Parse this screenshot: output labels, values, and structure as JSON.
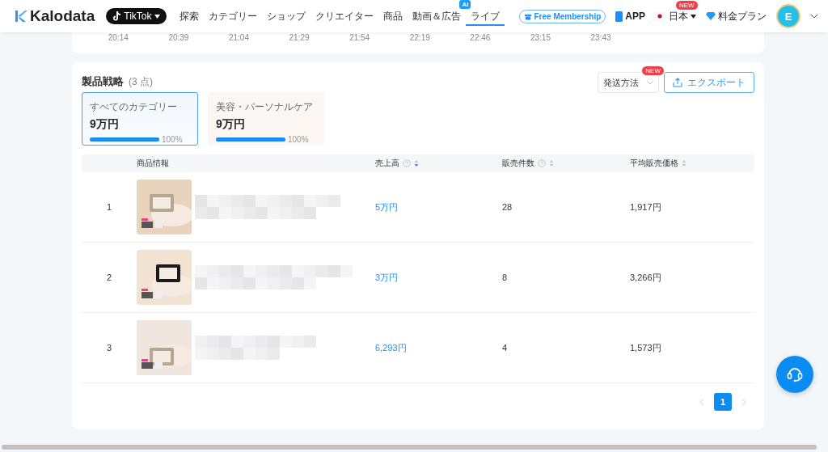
{
  "header": {
    "logo": "Kalodata",
    "platform": "TikTok",
    "nav": [
      {
        "label": "探索",
        "selected": false
      },
      {
        "label": "カテゴリー",
        "selected": false
      },
      {
        "label": "ショップ",
        "selected": false
      },
      {
        "label": "クリエイター",
        "selected": false
      },
      {
        "label": "商品",
        "selected": false
      },
      {
        "label": "動画＆広告",
        "selected": false,
        "badge": "Ai"
      },
      {
        "label": "ライブ",
        "selected": true
      }
    ],
    "membership": "Free Membership",
    "app": "APP",
    "region": "日本",
    "region_badge": "NEW",
    "pricing": "料金プラン",
    "avatar": "E"
  },
  "timeline_axis": [
    "20:14",
    "20:39",
    "21:04",
    "21:29",
    "21:54",
    "22:19",
    "22:46",
    "23:15",
    "23:43"
  ],
  "strategy": {
    "title": "製品戦略",
    "count": "(3 点)",
    "filter": "発送方法",
    "filter_badge": "NEW",
    "export": "エクスポート",
    "categories": [
      {
        "name": "すべてのカテゴリー",
        "value": "9万円",
        "level": 1,
        "percent": "100%",
        "selected": true
      },
      {
        "name": "美容・パーソナルケア",
        "value": "9万円",
        "level": 1,
        "percent": "100%",
        "selected": false
      }
    ],
    "columns": [
      {
        "label": "商品情報",
        "kind": "plain"
      },
      {
        "label": "売上高",
        "kind": "metric",
        "sorted": true
      },
      {
        "label": "販売件数",
        "kind": "metric",
        "sorted": false
      },
      {
        "label": "平均販売価格",
        "kind": "sortable",
        "sorted": false
      }
    ],
    "rows": [
      {
        "rank": "1",
        "sales": "5万円",
        "units": "28",
        "price": "1,917円"
      },
      {
        "rank": "2",
        "sales": "3万円",
        "units": "8",
        "price": "3,266円"
      },
      {
        "rank": "3",
        "sales": "6,293円",
        "units": "4",
        "price": "1,573円"
      }
    ],
    "pages": [
      {
        "label": "1",
        "selected": true
      }
    ]
  }
}
